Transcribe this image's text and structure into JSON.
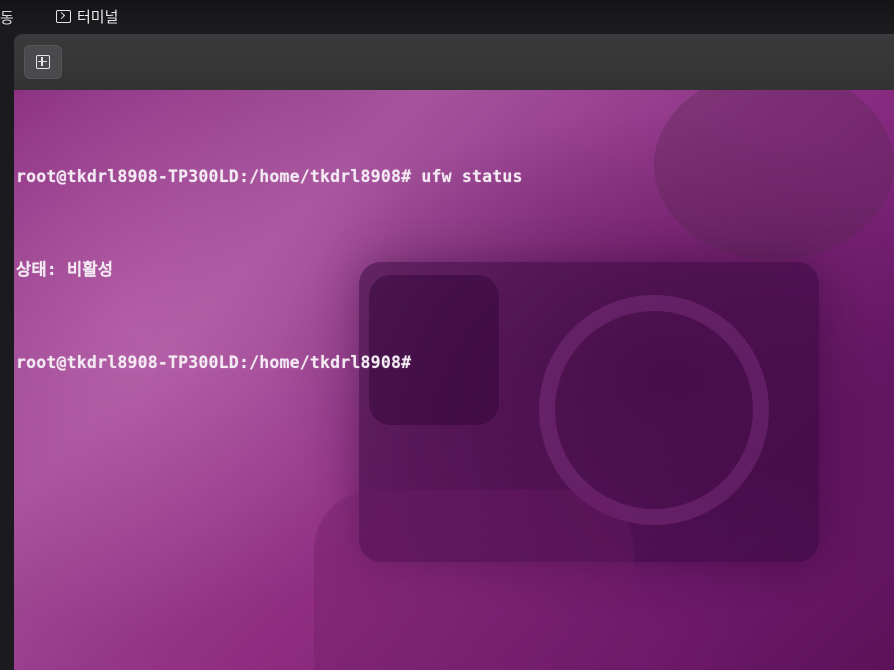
{
  "topbar": {
    "activities_fragment": "동",
    "app_name": "터미널",
    "app_icon": "terminal-icon"
  },
  "terminal_header": {
    "new_tab_icon": "tab-new-icon"
  },
  "terminal": {
    "lines": [
      "root@tkdrl8908-TP300LD:/home/tkdrl8908# ufw status",
      "상태: 비활성",
      "root@tkdrl8908-TP300LD:/home/tkdrl8908#"
    ],
    "background_color": "#8a2f80",
    "text_color": "#f4eaf3"
  }
}
